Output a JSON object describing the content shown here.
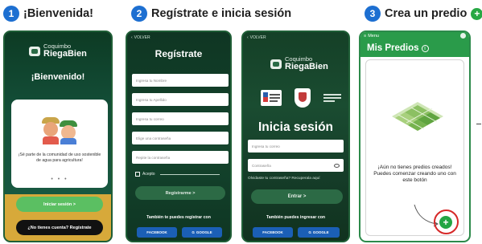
{
  "steps": [
    {
      "number": "1",
      "title": "¡Bienvenida!"
    },
    {
      "number": "2",
      "title": "Regístrate e inicia sesión"
    },
    {
      "number": "3",
      "title": "Crea un predio"
    }
  ],
  "brand": {
    "line1": "Coquimbo",
    "line2": "RiegaBien"
  },
  "screen1": {
    "welcome": "¡Bienvenido!",
    "card_text": "¡Sé parte de la comunidad de uso sostenible de agua para agricultura!",
    "dots": "• • •",
    "login_button": "Iniciar sesión >",
    "register_button": "¿No tienes cuenta? Regístrate"
  },
  "screen2": {
    "back": "VOLVER",
    "title": "Regístrate",
    "fields": [
      "Ingresa tu Nombre",
      "Ingresa tu Apellido",
      "Ingresa tu correo",
      "Elige una contraseña",
      "Repite la contraseña"
    ],
    "accept": "Acepto",
    "submit": "Regístrarme >",
    "social_text": "También te puedes registrar con",
    "facebook": "FACEBOOK",
    "google": "GOOGLE"
  },
  "screen3": {
    "back": "VOLVER",
    "title": "Inicia sesión",
    "fields": [
      "Ingresa tu correo",
      "Contraseña"
    ],
    "forgot": "Olvidaste tu contraseña? Recuperala aquí",
    "submit": "Entrar >",
    "social_text": "También puedes ingresar con",
    "facebook": "FACEBOOK",
    "google": "GOOGLE"
  },
  "screen4": {
    "menu": "Menu",
    "title": "Mis Predios",
    "empty_text": "¡Aún no tienes predios creados! Puedes comenzar creando uno con este botón",
    "fab": "+"
  },
  "colors": {
    "step_badge": "#1d6fd1",
    "brand_green": "#2a9b4a",
    "dark_green": "#14442d",
    "ring": "#d62828"
  }
}
